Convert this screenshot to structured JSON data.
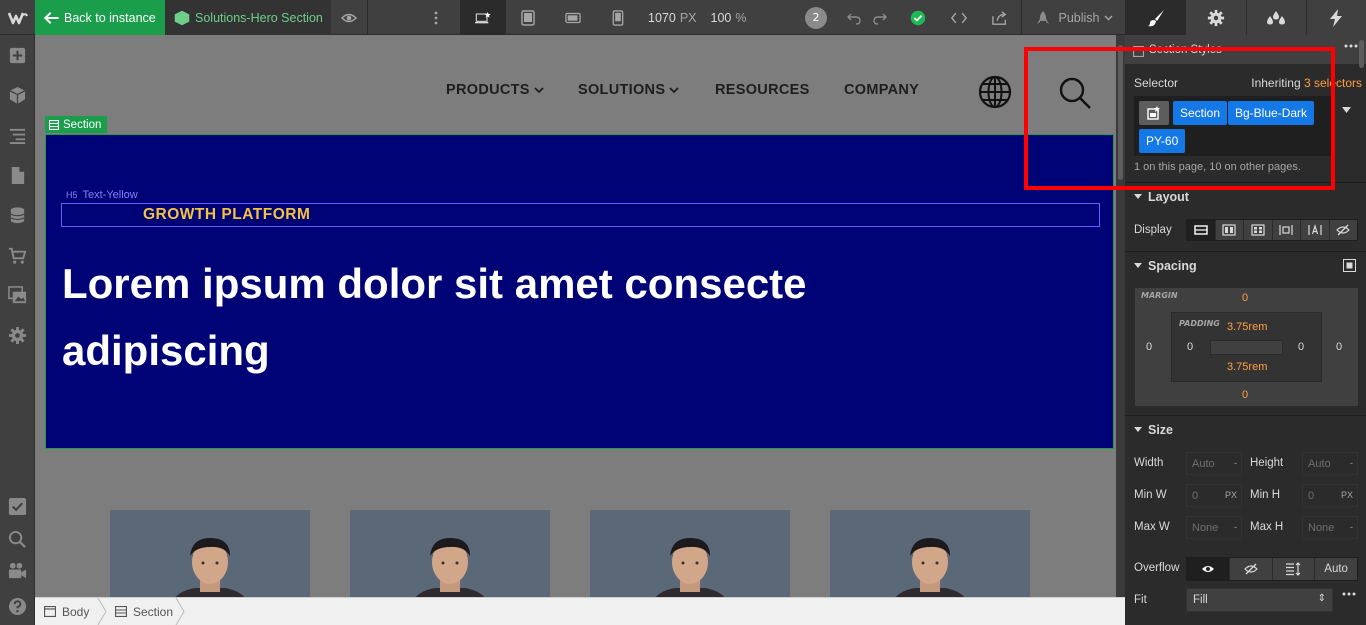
{
  "topbar": {
    "logo": "W",
    "back_label": "Back to instance",
    "component_name": "Solutions-Hero Section",
    "width_value": "1070",
    "width_unit": "PX",
    "zoom_value": "100",
    "zoom_unit": "%",
    "collaborators_count": "2",
    "publish_label": "Publish"
  },
  "canvas": {
    "nav": {
      "products": "PRODUCTS",
      "solutions": "SOLUTIONS",
      "resources": "RESOURCES",
      "company": "COMPANY"
    },
    "section_label": "Section",
    "h5_label": "Text-Yellow",
    "h5_tag": "H5",
    "eyebrow": "GROWTH PLATFORM",
    "headline_line1": "Lorem ipsum dolor sit amet consecte",
    "headline_line2": "adipiscing",
    "hero_color": "#000375",
    "eyebrow_color": "#f5c342"
  },
  "breadcrumb": {
    "items": [
      "Body",
      "Section"
    ]
  },
  "panel": {
    "title": "Section Styles",
    "selector_label": "Selector",
    "inheriting_prefix": "Inheriting",
    "inheriting_count": "3 selectors",
    "chips": [
      "Section",
      "Bg-Blue-Dark",
      "PY-60"
    ],
    "page_count_text": "1 on this page, 10 on other pages.",
    "layout_title": "Layout",
    "display_label": "Display",
    "spacing_title": "Spacing",
    "margin_label": "MARGIN",
    "padding_label": "PADDING",
    "margin": {
      "top": "0",
      "right": "0",
      "bottom": "0",
      "left": "0"
    },
    "padding": {
      "top": "3.75rem",
      "right": "0",
      "bottom": "3.75rem",
      "left": "0"
    },
    "size_title": "Size",
    "size": {
      "width_label": "Width",
      "width_value": "Auto",
      "height_label": "Height",
      "height_value": "Auto",
      "minw_label": "Min W",
      "minw_value": "0",
      "minw_unit": "PX",
      "minh_label": "Min H",
      "minh_value": "0",
      "minh_unit": "PX",
      "maxw_label": "Max W",
      "maxw_value": "None",
      "maxh_label": "Max H",
      "maxh_value": "None",
      "dash": "-"
    },
    "overflow_label": "Overflow",
    "overflow_auto": "Auto",
    "fit_label": "Fit",
    "fit_value": "Fill",
    "highlight_color": "#ff0000",
    "accent_color": "#1478e6"
  }
}
